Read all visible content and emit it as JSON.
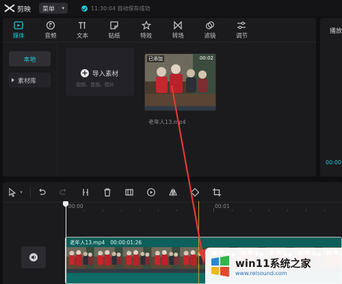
{
  "app": {
    "name": "剪映",
    "menu_label": "菜单",
    "save_status": "11:30:04 自动保存成功"
  },
  "tabs": [
    {
      "label": "媒体",
      "icon": "media-icon",
      "active": true
    },
    {
      "label": "音频",
      "icon": "audio-icon"
    },
    {
      "label": "文本",
      "icon": "text-icon"
    },
    {
      "label": "贴纸",
      "icon": "sticker-icon"
    },
    {
      "label": "特效",
      "icon": "effects-icon"
    },
    {
      "label": "转场",
      "icon": "transition-icon"
    },
    {
      "label": "滤镜",
      "icon": "filter-icon"
    },
    {
      "label": "调节",
      "icon": "adjust-icon"
    }
  ],
  "sidebar": {
    "items": [
      {
        "label": "本地",
        "active": true
      },
      {
        "label": "素材库"
      }
    ]
  },
  "import": {
    "title": "导入素材",
    "subtitle": "视频、音频、图片"
  },
  "media_clip": {
    "tag": "已添加",
    "duration": "00:02",
    "filename": "老年人13.mp4"
  },
  "player": {
    "title": "播放",
    "time": "00:00"
  },
  "timeline": {
    "ruler": [
      "00:00",
      "00:01"
    ],
    "clip": {
      "name": "老年人13.mp4",
      "duration": "00:00:01:26"
    }
  },
  "watermark": {
    "title": "win11系统之家",
    "url": "www.relsound.com"
  },
  "colors": {
    "accent": "#1ec9d6",
    "track": "#0e6b66",
    "annotation": "#e53935"
  }
}
